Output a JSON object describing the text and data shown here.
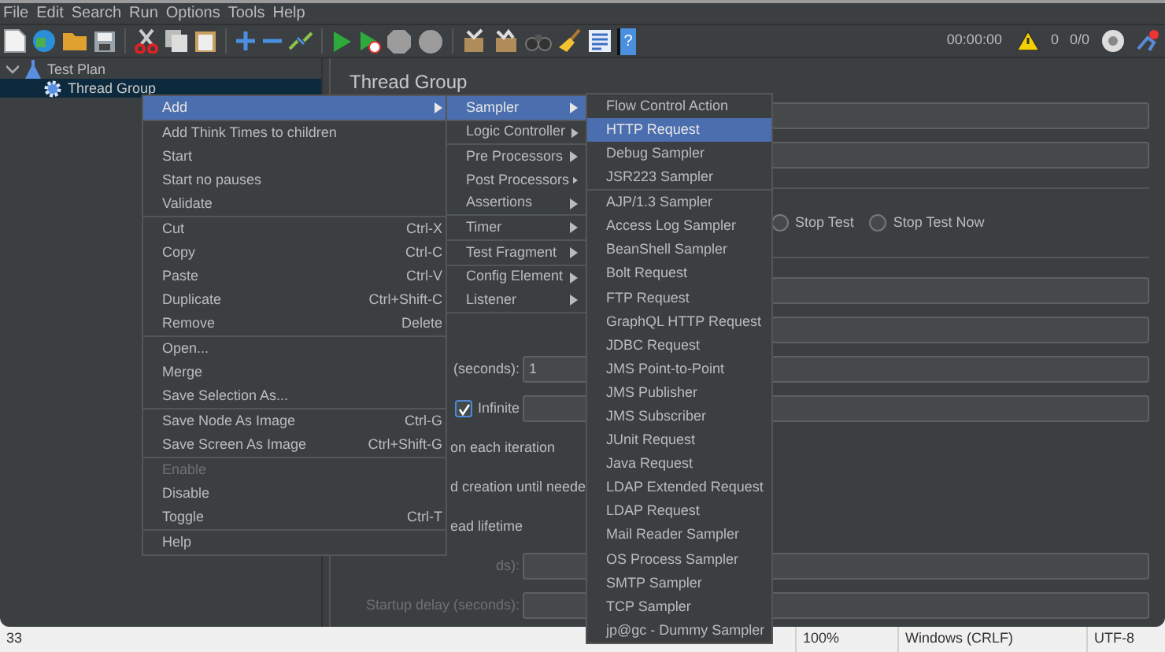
{
  "menubar": [
    {
      "label": "File"
    },
    {
      "label": "Edit"
    },
    {
      "label": "Search"
    },
    {
      "label": "Run"
    },
    {
      "label": "Options"
    },
    {
      "label": "Tools"
    },
    {
      "label": "Help"
    }
  ],
  "toolbar": {
    "help": "?",
    "timer": "00:00:00",
    "warnings": "0",
    "threads": "0/0"
  },
  "tree": [
    {
      "label": "Test Plan",
      "expanded": true,
      "selected": false,
      "children": [
        {
          "label": "Thread Group",
          "selected": true
        }
      ]
    }
  ],
  "panel": {
    "title": "Thread Group",
    "rows": [
      {
        "kind": "field",
        "label": "",
        "value": ""
      },
      {
        "kind": "field",
        "label": "",
        "value": ""
      },
      {
        "kind": "divider"
      },
      {
        "kind": "radios",
        "options": [
          {
            "label": "Stop Test",
            "selected": false
          },
          {
            "label": "Stop Test Now",
            "selected": false
          }
        ]
      },
      {
        "kind": "divider"
      },
      {
        "kind": "field",
        "label": "",
        "value": ""
      },
      {
        "kind": "field",
        "label": "",
        "value": ""
      },
      {
        "kind": "field",
        "label": "(seconds):",
        "value": "1"
      },
      {
        "kind": "check",
        "label": "Infinite",
        "checked": true
      },
      {
        "kind": "text",
        "label": "on each iteration"
      },
      {
        "kind": "text",
        "label": "d creation until neede"
      },
      {
        "kind": "text",
        "label": "ead lifetime"
      },
      {
        "kind": "field",
        "label": "ds):",
        "value": "",
        "disabled": true
      },
      {
        "kind": "field",
        "label": "Startup delay (seconds):",
        "value": "",
        "disabled": true
      }
    ]
  },
  "context_menu": [
    [
      {
        "label": "Add",
        "selected": true,
        "submenu": true
      }
    ],
    [
      {
        "label": "Add Think Times to children"
      },
      {
        "label": "Start"
      },
      {
        "label": "Start no pauses"
      },
      {
        "label": "Validate"
      }
    ],
    [
      {
        "label": "Cut",
        "shortcut": "Ctrl-X"
      },
      {
        "label": "Copy",
        "shortcut": "Ctrl-C"
      },
      {
        "label": "Paste",
        "shortcut": "Ctrl-V"
      },
      {
        "label": "Duplicate",
        "shortcut": "Ctrl+Shift-C"
      },
      {
        "label": "Remove",
        "shortcut": "Delete"
      }
    ],
    [
      {
        "label": "Open..."
      },
      {
        "label": "Merge"
      },
      {
        "label": "Save Selection As..."
      }
    ],
    [
      {
        "label": "Save Node As Image",
        "shortcut": "Ctrl-G"
      },
      {
        "label": "Save Screen As Image",
        "shortcut": "Ctrl+Shift-G"
      }
    ],
    [
      {
        "label": "Enable",
        "disabled": true
      },
      {
        "label": "Disable"
      },
      {
        "label": "Toggle",
        "shortcut": "Ctrl-T"
      }
    ],
    [
      {
        "label": "Help"
      }
    ]
  ],
  "add_submenu": [
    [
      {
        "label": "Sampler",
        "selected": true,
        "submenu": true
      }
    ],
    [
      {
        "label": "Logic Controller",
        "submenu": true
      }
    ],
    [
      {
        "label": "Pre Processors",
        "submenu": true
      },
      {
        "label": "Post Processors",
        "submenu": true
      },
      {
        "label": "Assertions",
        "submenu": true
      }
    ],
    [
      {
        "label": "Timer",
        "submenu": true
      }
    ],
    [
      {
        "label": "Test Fragment",
        "submenu": true
      }
    ],
    [
      {
        "label": "Config Element",
        "submenu": true
      },
      {
        "label": "Listener",
        "submenu": true
      }
    ]
  ],
  "sampler_submenu": [
    [
      {
        "label": "Flow Control Action"
      },
      {
        "label": "HTTP Request",
        "selected": true
      },
      {
        "label": "Debug Sampler"
      },
      {
        "label": "JSR223 Sampler"
      }
    ],
    [
      {
        "label": "AJP/1.3 Sampler"
      },
      {
        "label": "Access Log Sampler"
      },
      {
        "label": "BeanShell Sampler"
      },
      {
        "label": "Bolt Request"
      },
      {
        "label": "FTP Request"
      },
      {
        "label": "GraphQL HTTP Request"
      },
      {
        "label": "JDBC Request"
      },
      {
        "label": "JMS Point-to-Point"
      },
      {
        "label": "JMS Publisher"
      },
      {
        "label": "JMS Subscriber"
      },
      {
        "label": "JUnit Request"
      },
      {
        "label": "Java Request"
      },
      {
        "label": "LDAP Extended Request"
      },
      {
        "label": "LDAP Request"
      },
      {
        "label": "Mail Reader Sampler"
      },
      {
        "label": "OS Process Sampler"
      },
      {
        "label": "SMTP Sampler"
      },
      {
        "label": "TCP Sampler"
      },
      {
        "label": "jp@gc - Dummy Sampler"
      }
    ]
  ],
  "status_bar": [
    "33",
    "100%",
    "Windows (CRLF)",
    "UTF-8"
  ]
}
